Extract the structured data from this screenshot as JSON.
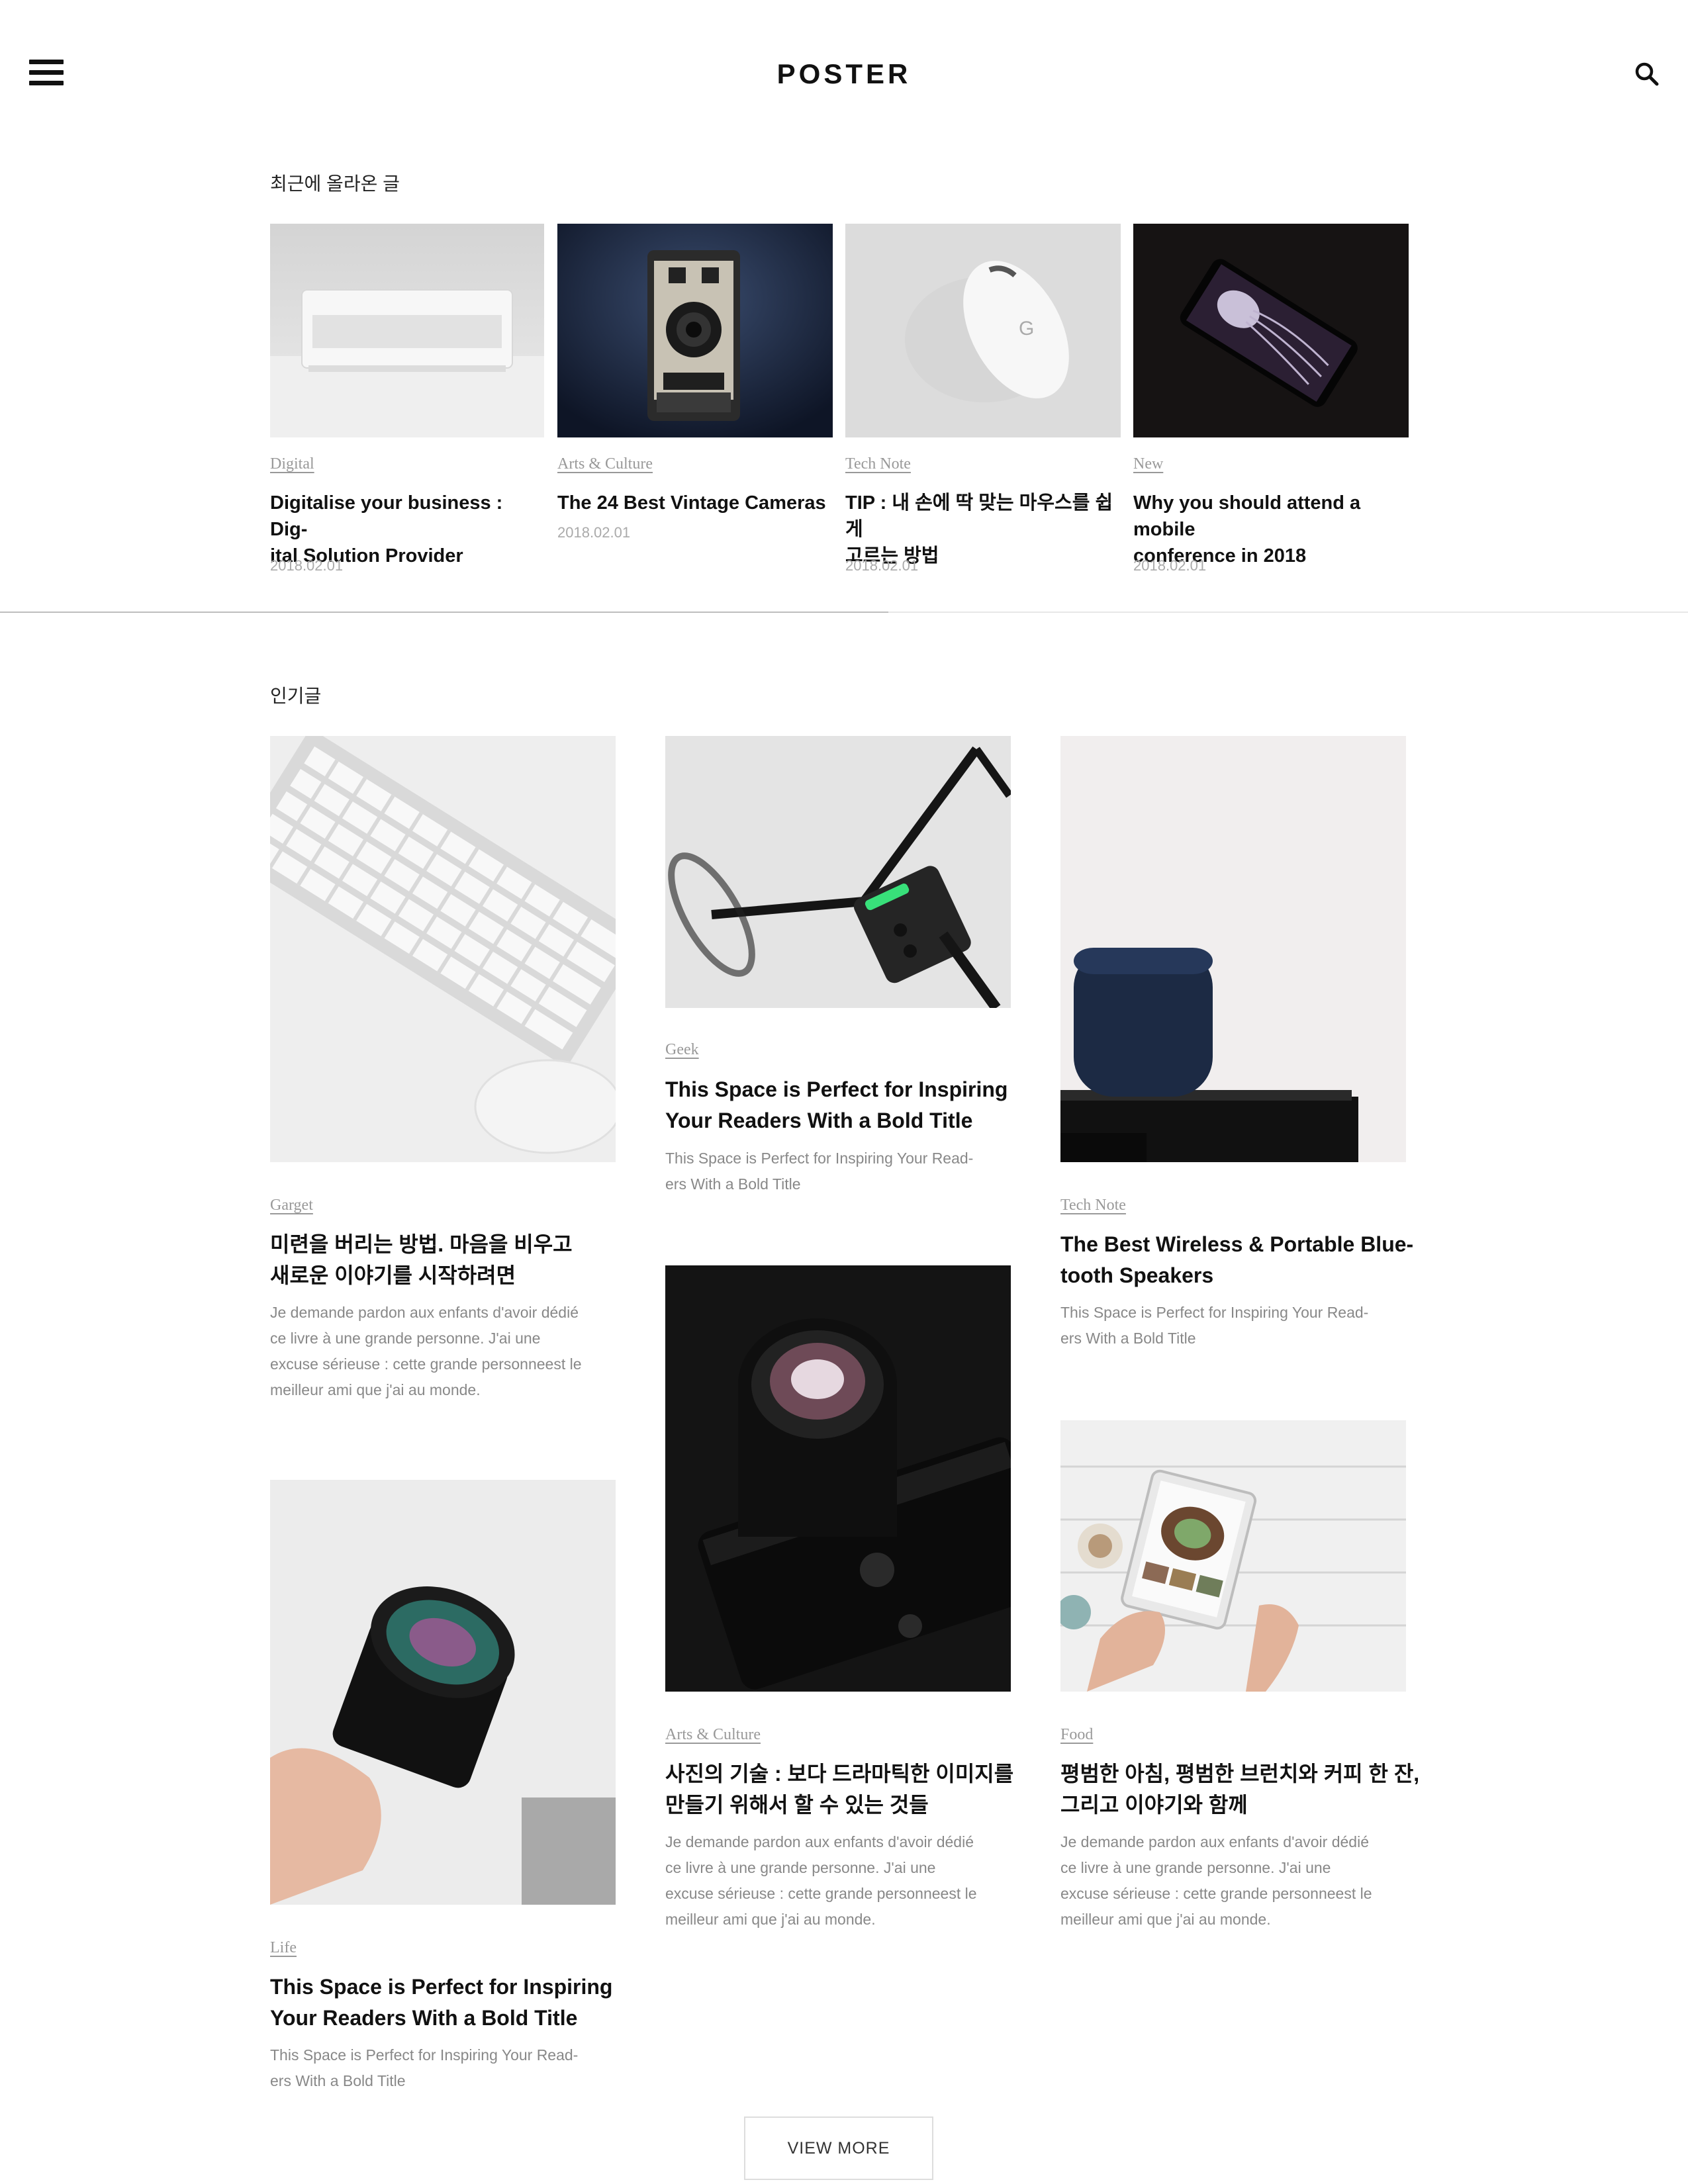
{
  "header": {
    "logo": "POSTER",
    "menu_icon": "hamburger-menu-icon",
    "search_icon": "search-icon"
  },
  "recent": {
    "label": "최근에 올라온 글",
    "posts": [
      {
        "category": "Digital",
        "title_lines": [
          "Digitalise your business : Dig-",
          "ital Solution Provider"
        ],
        "date": "2018.02.01"
      },
      {
        "category": "Arts & Culture",
        "title_lines": [
          "The 24 Best Vintage Cameras"
        ],
        "date": "2018.02.01"
      },
      {
        "category": "Tech Note",
        "title_lines": [
          "TIP : 내 손에 딱 맞는 마우스를 쉽게",
          "고르는 방법"
        ],
        "date": "2018.02.01"
      },
      {
        "category": "New",
        "title_lines": [
          "Why you should attend a mobile",
          "conference in 2018"
        ],
        "date": "2018.02.01"
      }
    ]
  },
  "popular": {
    "label": "인기글",
    "posts": [
      {
        "category": "Garget",
        "title_lines": [
          "미련을 버리는 방법. 마음을 비우고",
          "새로운 이야기를 시작하려면"
        ],
        "excerpt_lines": [
          "Je demande pardon aux enfants d'avoir dédié",
          "ce livre à une grande personne. J'ai une",
          "excuse sérieuse : cette grande personneest le",
          "meilleur ami que j'ai au monde."
        ]
      },
      {
        "category": "Geek",
        "title_lines": [
          "This Space is Perfect for Inspiring",
          "Your Readers With a Bold Title"
        ],
        "excerpt_lines": [
          "This Space is Perfect for Inspiring Your Read-",
          "ers With a Bold Title"
        ]
      },
      {
        "category": "Tech Note",
        "title_lines": [
          "The Best Wireless & Portable Blue-",
          "tooth Speakers"
        ],
        "excerpt_lines": [
          "This Space is Perfect for Inspiring Your Read-",
          "ers With a Bold Title"
        ]
      },
      {
        "category": "Life",
        "title_lines": [
          "This Space is Perfect for Inspiring",
          "Your Readers With a Bold Title"
        ],
        "excerpt_lines": [
          "This Space is Perfect for Inspiring Your Read-",
          "ers With a Bold Title"
        ]
      },
      {
        "category": "Arts & Culture",
        "title_lines": [
          "사진의 기술 : 보다 드라마틱한 이미지를",
          "만들기 위해서 할 수 있는 것들"
        ],
        "excerpt_lines": [
          "Je demande pardon aux enfants d'avoir dédié",
          "ce livre à une grande personne. J'ai une",
          "excuse sérieuse : cette grande personneest le",
          "meilleur ami que j'ai au monde."
        ]
      },
      {
        "category": "Food",
        "title_lines": [
          "평범한 아침, 평범한 브런치와 커피 한 잔,",
          "그리고 이야기와 함께"
        ],
        "excerpt_lines": [
          "Je demande pardon aux enfants d'avoir dédié",
          "ce livre à une grande personne. J'ai une",
          "excuse sérieuse : cette grande personneest le",
          "meilleur ami que j'ai au monde."
        ]
      }
    ]
  },
  "view_more": "VIEW MORE"
}
